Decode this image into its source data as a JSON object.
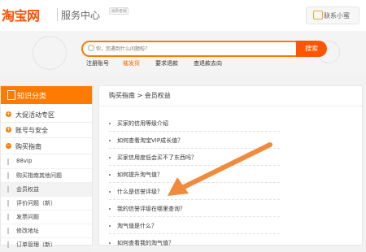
{
  "header": {
    "logo_text": "淘宝网",
    "subtitle": "服务中心",
    "badge": "消费者版",
    "contact_label": "联系小蜜"
  },
  "search": {
    "placeholder": "你，您遇到什么问题啦？",
    "button_label": "搜索",
    "quick_links": [
      {
        "label": "注册账号",
        "active": false
      },
      {
        "label": "催发货",
        "active": true
      },
      {
        "label": "要求退款",
        "active": false
      },
      {
        "label": "查退款去向",
        "active": false
      }
    ]
  },
  "sidebar": {
    "title": "知识分类",
    "categories": [
      {
        "label": "大促活动专区",
        "icon": "+"
      },
      {
        "label": "账号与安全",
        "icon": "+"
      },
      {
        "label": "购买指南",
        "icon": "−"
      }
    ],
    "sub_items": [
      {
        "label": "88vip",
        "active": false
      },
      {
        "label": "购买指南其他问题",
        "active": false
      },
      {
        "label": "会员权益",
        "active": true
      },
      {
        "label": "评价问题（新）",
        "active": false
      },
      {
        "label": "发票问题",
        "active": false
      },
      {
        "label": "修改地址",
        "active": false
      },
      {
        "label": "订单管理（新）",
        "active": false
      }
    ]
  },
  "main": {
    "breadcrumb": "购买指南 > 会员权益",
    "faq_items": [
      "买家的信用等级介绍",
      "如何查看淘宝VIP成长值？",
      "买家信用度低会买不了东西吗？",
      "如何提升淘气值？",
      "什么是信誉评级？",
      "我的信誉评级在哪里查询？",
      "淘气值是什么？",
      "如何查看我的淘气值？"
    ]
  },
  "colors": {
    "brand": "#ff5000",
    "accent": "#ff7a00",
    "arrow": "#f08a3c"
  },
  "icons": [
    "search-icon",
    "chat-icon",
    "book-icon",
    "plus-icon",
    "minus-icon",
    "arrow-annotation"
  ]
}
